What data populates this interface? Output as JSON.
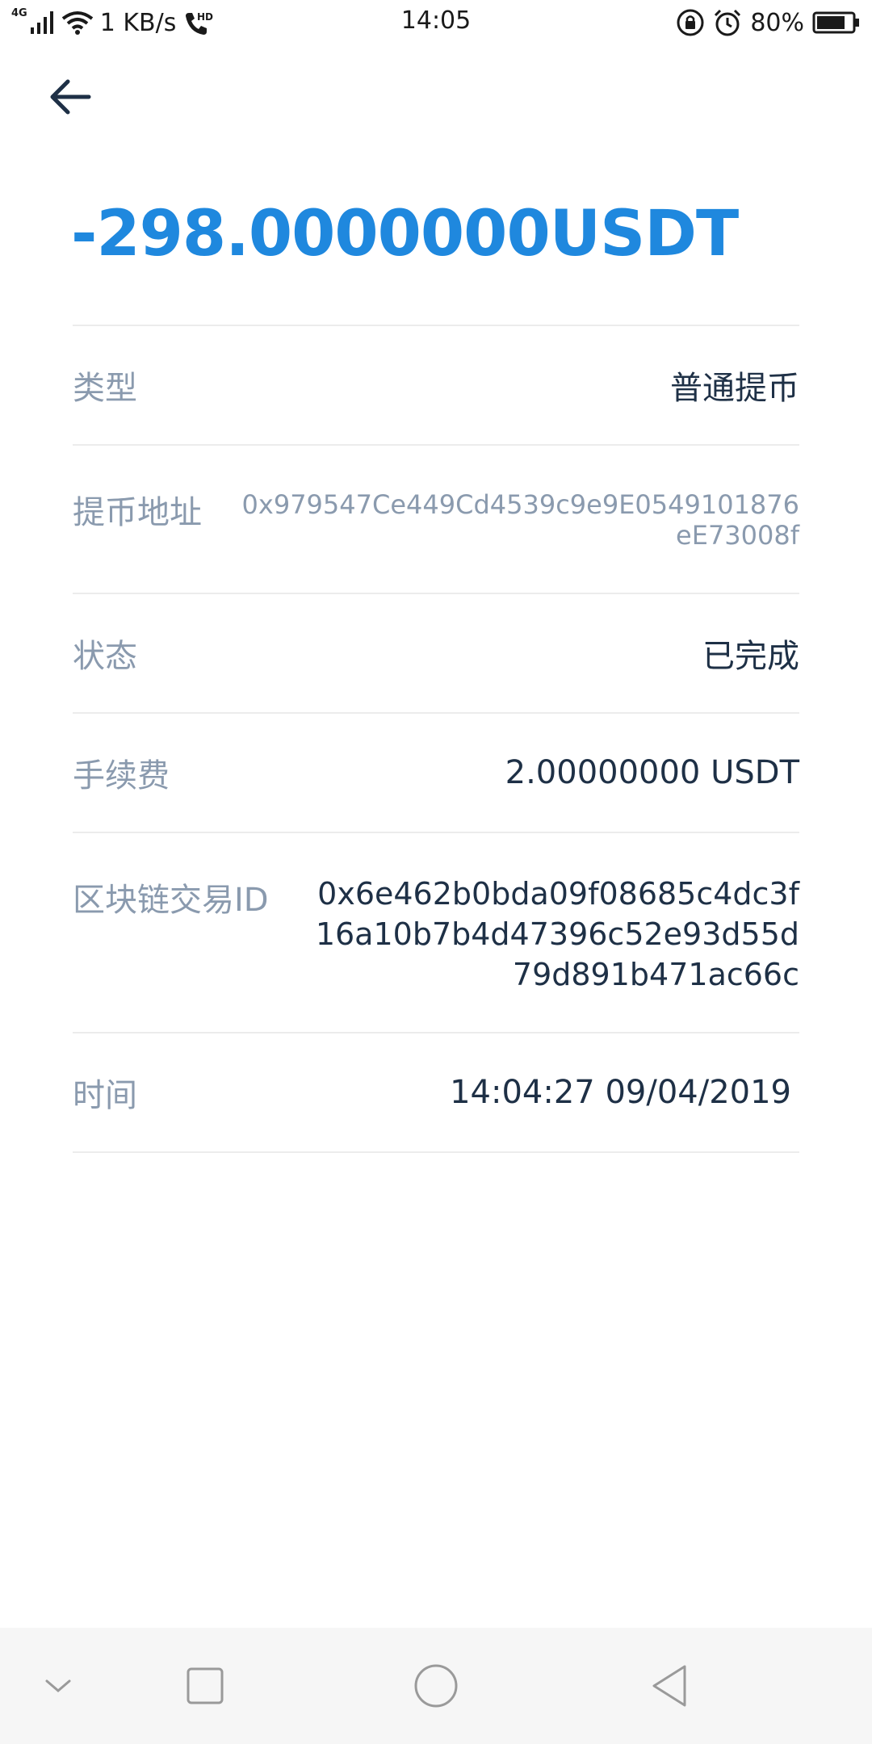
{
  "status_bar": {
    "network_type": "4G",
    "speed": "1 KB/s",
    "call_badge": "HD",
    "time": "14:05",
    "battery": "80%",
    "battery_level": 0.8
  },
  "transaction": {
    "amount": "-298.0000000USDT",
    "amount_color": "#1f88de",
    "rows": {
      "type": {
        "label": "类型",
        "value": "普通提币"
      },
      "address": {
        "label": "提币地址",
        "value": "0x979547Ce449Cd4539c9e9E0549101876eE73008f"
      },
      "status": {
        "label": "状态",
        "value": "已完成"
      },
      "fee": {
        "label": "手续费",
        "value": "2.00000000 USDT"
      },
      "txid": {
        "label": "区块链交易ID",
        "value": "0x6e462b0bda09f08685c4dc3f16a10b7b4d47396c52e93d55d79d891b471ac66c"
      },
      "time": {
        "label": "时间",
        "value": "14:04:27 09/04/2019"
      }
    }
  },
  "nav_bar": {
    "icons": [
      "chevron-down-icon",
      "recents-square-icon",
      "home-circle-icon",
      "back-triangle-icon"
    ]
  }
}
